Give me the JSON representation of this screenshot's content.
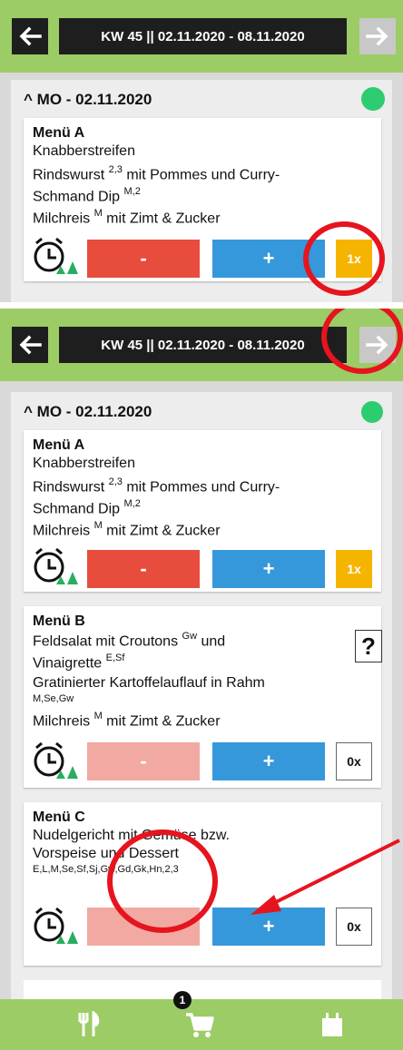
{
  "header": {
    "week_label": "KW 45 || 02.11.2020 - 08.11.2020",
    "back_icon": "arrow-left-icon",
    "forward_icon": "arrow-right-icon"
  },
  "day": {
    "title": "MO - 02.11.2020",
    "chevron": "^",
    "status_color": "#2ecc71"
  },
  "menus": [
    {
      "title": "Menü A",
      "line1": "Knabberstreifen",
      "line2a": "Rindswurst ",
      "line2a_sup": "2,3",
      "line2b": " mit Pommes und Curry-",
      "line3a": "Schmand Dip ",
      "line3a_sup": "M,2",
      "line4a": "Milchreis ",
      "line4a_sup": "M",
      "line4b": " mit Zimt & Zucker",
      "minus": "-",
      "plus": "+",
      "qty": "1x"
    },
    {
      "title": "Menü B",
      "line1a": "Feldsalat mit Croutons ",
      "line1a_sup": "Gw",
      "line1b": " und",
      "line2a": "Vinaigrette ",
      "line2a_sup": "E,Sf",
      "line3": "Gratinierter Kartoffelauflauf in Rahm",
      "allergens": "M,Se,Gw",
      "line4a": "Milchreis ",
      "line4a_sup": "M",
      "line4b": " mit Zimt & Zucker",
      "info": "?",
      "minus": "-",
      "plus": "+",
      "qty": "0x"
    },
    {
      "title": "Menü C",
      "line1": "Nudelgericht mit Gemüse bzw.",
      "line2": "Vorspeise und Dessert",
      "allergens": "E,L,M,Se,Sf,Sj,Gw,Gd,Gk,Hn,2,3",
      "minus": "-",
      "plus": "+",
      "qty": "0x"
    }
  ],
  "bottom_nav": {
    "cart_count": "1",
    "items": [
      "cutlery-icon",
      "cart-icon",
      "calendar-icon"
    ]
  },
  "colors": {
    "header_green": "#9ccc65",
    "minus_red": "#e74c3c",
    "minus_disabled": "#f1a9a2",
    "plus_blue": "#3498db",
    "qty_active": "#f5b400",
    "annotation_red": "#e6141e"
  }
}
